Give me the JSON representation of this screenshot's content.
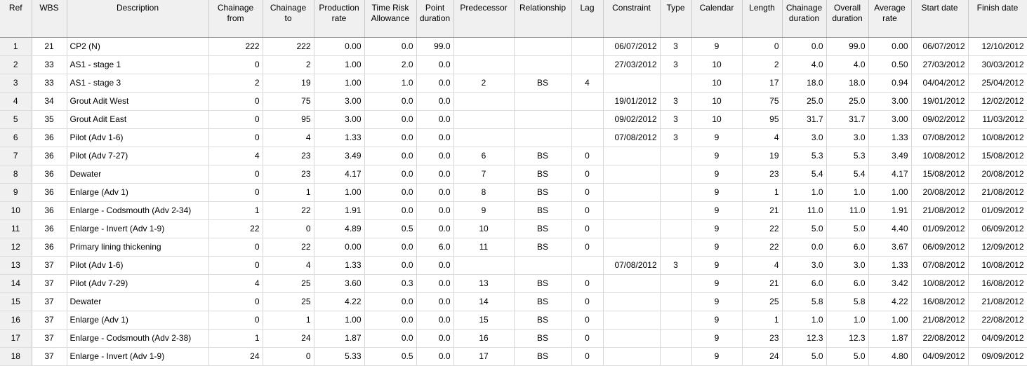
{
  "columns": [
    {
      "label": "Ref",
      "align": "c"
    },
    {
      "label": "WBS",
      "align": "c"
    },
    {
      "label": "Description",
      "align": "l"
    },
    {
      "label": "Chainage\nfrom",
      "align": "r"
    },
    {
      "label": "Chainage\nto",
      "align": "r"
    },
    {
      "label": "Production\nrate",
      "align": "r"
    },
    {
      "label": "Time Risk\nAllowance",
      "align": "r"
    },
    {
      "label": "Point\nduration",
      "align": "r"
    },
    {
      "label": "Predecessor",
      "align": "c"
    },
    {
      "label": "Relationship",
      "align": "c"
    },
    {
      "label": "Lag",
      "align": "c"
    },
    {
      "label": "Constraint",
      "align": "r"
    },
    {
      "label": "Type",
      "align": "c"
    },
    {
      "label": "Calendar",
      "align": "c"
    },
    {
      "label": "Length",
      "align": "r"
    },
    {
      "label": "Chainage\nduration",
      "align": "r"
    },
    {
      "label": "Overall\nduration",
      "align": "r"
    },
    {
      "label": "Average\nrate",
      "align": "r"
    },
    {
      "label": "Start date",
      "align": "r"
    },
    {
      "label": "Finish date",
      "align": "r"
    }
  ],
  "rows": [
    [
      "1",
      "21",
      "CP2 (N)",
      "222",
      "222",
      "0.00",
      "0.0",
      "99.0",
      "",
      "",
      "",
      "06/07/2012",
      "3",
      "9",
      "0",
      "0.0",
      "99.0",
      "0.00",
      "06/07/2012",
      "12/10/2012"
    ],
    [
      "2",
      "33",
      "AS1 - stage 1",
      "0",
      "2",
      "1.00",
      "2.0",
      "0.0",
      "",
      "",
      "",
      "27/03/2012",
      "3",
      "10",
      "2",
      "4.0",
      "4.0",
      "0.50",
      "27/03/2012",
      "30/03/2012"
    ],
    [
      "3",
      "33",
      "AS1 - stage 3",
      "2",
      "19",
      "1.00",
      "1.0",
      "0.0",
      "2",
      "BS",
      "4",
      "",
      "",
      "10",
      "17",
      "18.0",
      "18.0",
      "0.94",
      "04/04/2012",
      "25/04/2012"
    ],
    [
      "4",
      "34",
      "Grout Adit West",
      "0",
      "75",
      "3.00",
      "0.0",
      "0.0",
      "",
      "",
      "",
      "19/01/2012",
      "3",
      "10",
      "75",
      "25.0",
      "25.0",
      "3.00",
      "19/01/2012",
      "12/02/2012"
    ],
    [
      "5",
      "35",
      "Grout Adit East",
      "0",
      "95",
      "3.00",
      "0.0",
      "0.0",
      "",
      "",
      "",
      "09/02/2012",
      "3",
      "10",
      "95",
      "31.7",
      "31.7",
      "3.00",
      "09/02/2012",
      "11/03/2012"
    ],
    [
      "6",
      "36",
      "Pilot (Adv 1-6)",
      "0",
      "4",
      "1.33",
      "0.0",
      "0.0",
      "",
      "",
      "",
      "07/08/2012",
      "3",
      "9",
      "4",
      "3.0",
      "3.0",
      "1.33",
      "07/08/2012",
      "10/08/2012"
    ],
    [
      "7",
      "36",
      "Pilot (Adv 7-27)",
      "4",
      "23",
      "3.49",
      "0.0",
      "0.0",
      "6",
      "BS",
      "0",
      "",
      "",
      "9",
      "19",
      "5.3",
      "5.3",
      "3.49",
      "10/08/2012",
      "15/08/2012"
    ],
    [
      "8",
      "36",
      "Dewater",
      "0",
      "23",
      "4.17",
      "0.0",
      "0.0",
      "7",
      "BS",
      "0",
      "",
      "",
      "9",
      "23",
      "5.4",
      "5.4",
      "4.17",
      "15/08/2012",
      "20/08/2012"
    ],
    [
      "9",
      "36",
      "Enlarge (Adv 1)",
      "0",
      "1",
      "1.00",
      "0.0",
      "0.0",
      "8",
      "BS",
      "0",
      "",
      "",
      "9",
      "1",
      "1.0",
      "1.0",
      "1.00",
      "20/08/2012",
      "21/08/2012"
    ],
    [
      "10",
      "36",
      "Enlarge - Codsmouth (Adv 2-34)",
      "1",
      "22",
      "1.91",
      "0.0",
      "0.0",
      "9",
      "BS",
      "0",
      "",
      "",
      "9",
      "21",
      "11.0",
      "11.0",
      "1.91",
      "21/08/2012",
      "01/09/2012"
    ],
    [
      "11",
      "36",
      "Enlarge - Invert (Adv 1-9)",
      "22",
      "0",
      "4.89",
      "0.5",
      "0.0",
      "10",
      "BS",
      "0",
      "",
      "",
      "9",
      "22",
      "5.0",
      "5.0",
      "4.40",
      "01/09/2012",
      "06/09/2012"
    ],
    [
      "12",
      "36",
      "Primary lining thickening",
      "0",
      "22",
      "0.00",
      "0.0",
      "6.0",
      "11",
      "BS",
      "0",
      "",
      "",
      "9",
      "22",
      "0.0",
      "6.0",
      "3.67",
      "06/09/2012",
      "12/09/2012"
    ],
    [
      "13",
      "37",
      "Pilot (Adv 1-6)",
      "0",
      "4",
      "1.33",
      "0.0",
      "0.0",
      "",
      "",
      "",
      "07/08/2012",
      "3",
      "9",
      "4",
      "3.0",
      "3.0",
      "1.33",
      "07/08/2012",
      "10/08/2012"
    ],
    [
      "14",
      "37",
      "Pilot (Adv 7-29)",
      "4",
      "25",
      "3.60",
      "0.3",
      "0.0",
      "13",
      "BS",
      "0",
      "",
      "",
      "9",
      "21",
      "6.0",
      "6.0",
      "3.42",
      "10/08/2012",
      "16/08/2012"
    ],
    [
      "15",
      "37",
      "Dewater",
      "0",
      "25",
      "4.22",
      "0.0",
      "0.0",
      "14",
      "BS",
      "0",
      "",
      "",
      "9",
      "25",
      "5.8",
      "5.8",
      "4.22",
      "16/08/2012",
      "21/08/2012"
    ],
    [
      "16",
      "37",
      "Enlarge (Adv 1)",
      "0",
      "1",
      "1.00",
      "0.0",
      "0.0",
      "15",
      "BS",
      "0",
      "",
      "",
      "9",
      "1",
      "1.0",
      "1.0",
      "1.00",
      "21/08/2012",
      "22/08/2012"
    ],
    [
      "17",
      "37",
      "Enlarge - Codsmouth (Adv 2-38)",
      "1",
      "24",
      "1.87",
      "0.0",
      "0.0",
      "16",
      "BS",
      "0",
      "",
      "",
      "9",
      "23",
      "12.3",
      "12.3",
      "1.87",
      "22/08/2012",
      "04/09/2012"
    ],
    [
      "18",
      "37",
      "Enlarge - Invert (Adv 1-9)",
      "24",
      "0",
      "5.33",
      "0.5",
      "0.0",
      "17",
      "BS",
      "0",
      "",
      "",
      "9",
      "24",
      "5.0",
      "5.0",
      "4.80",
      "04/09/2012",
      "09/09/2012"
    ]
  ]
}
